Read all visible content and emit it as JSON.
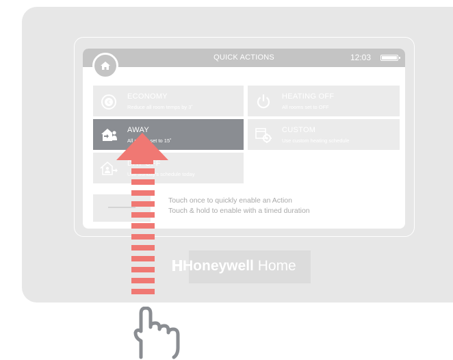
{
  "header": {
    "title": "QUICK ACTIONS",
    "time": "12:03"
  },
  "tiles": [
    {
      "id": "economy",
      "title": "ECONOMY",
      "subtitle": "Reduce all room temps by 3˚",
      "icon": "euro-house-icon",
      "active": false
    },
    {
      "id": "heating_off",
      "title": "HEATING OFF",
      "subtitle": "All rooms set to OFF",
      "icon": "power-icon",
      "active": false
    },
    {
      "id": "away",
      "title": "AWAY",
      "subtitle": "All rooms set to 15˚",
      "icon": "away-house-icon",
      "active": true
    },
    {
      "id": "custom",
      "title": "CUSTOM",
      "subtitle": "Use custom heating schedule",
      "icon": "calendar-gear-icon",
      "active": false
    },
    {
      "id": "day_off",
      "title": "DAY OFF",
      "subtitle": "Use Sunday's schedule today",
      "icon": "day-off-house-icon",
      "active": false
    }
  ],
  "hint": {
    "line1": "Touch once to quickly enable an Action",
    "line2": "Touch & hold to enable with a timed duration"
  },
  "brand": {
    "name": "Honeywell",
    "suffix": "Home"
  },
  "colors": {
    "device": "#e7e7e7",
    "topbar": "#c4c4c4",
    "tile": "#ebebeb",
    "tile_active": "#8a8d92",
    "swipe_arrow": "#f07873",
    "hand_outline": "#8a8d92"
  }
}
